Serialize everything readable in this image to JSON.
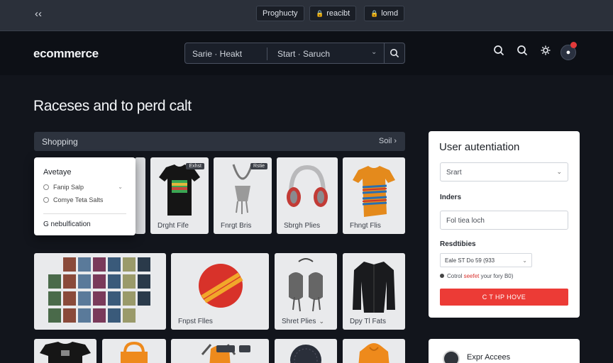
{
  "topbar": {
    "pills": [
      "Proghucty",
      "reacibt",
      "lomd"
    ]
  },
  "header": {
    "logo": "ecommerce",
    "search": {
      "segment1": "Sarie · Heakt",
      "segment2": "Start · Saruch"
    }
  },
  "page": {
    "title": "Raceses and to perd calt"
  },
  "shopping_bar": {
    "label": "Shopping",
    "sort": "Soil"
  },
  "dropdown": {
    "header": "Avetaye",
    "options": [
      "Fanip Salp",
      "Comye Teta Salts"
    ],
    "footer": "G nebulfication"
  },
  "products": [
    {
      "caption": "Drght Fife",
      "tag": "Exhst"
    },
    {
      "caption": "Fnrgt Bris",
      "tag": "Rstie"
    },
    {
      "caption": "Sbrgh Plies"
    },
    {
      "caption": "Fhngt Flis"
    },
    {
      "caption": ""
    },
    {
      "caption": "Fnpst Flles"
    },
    {
      "caption": "Shret Plies"
    },
    {
      "caption": "Dpy Tl Fats"
    }
  ],
  "auth": {
    "title": "User autentiation",
    "start_value": "Srart",
    "label1": "Inders",
    "input_value": "Fol tiea loch",
    "label2": "Resdtibies",
    "select_value": "Eale ST Do 59 (933",
    "consent_prefix": "Cotrol",
    "consent_red": "seefet",
    "consent_suffix": "your fory B0)",
    "submit": "C T HP HOVE"
  },
  "expr": {
    "title": "Expr Accees"
  },
  "colors": {
    "background": "#12151c",
    "accent_red": "#ec3b36",
    "topbar": "#2b303a"
  }
}
